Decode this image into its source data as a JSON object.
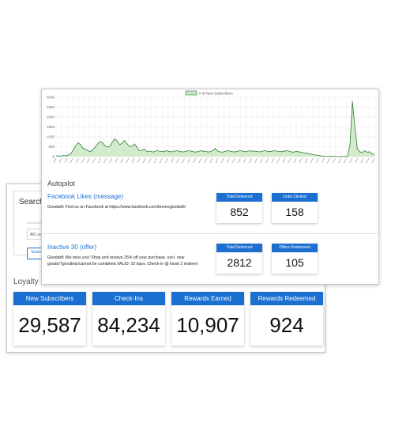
{
  "search": {
    "title": "Search",
    "location_label": "LOCATION",
    "location_value": "All Locations",
    "button_label": "Search"
  },
  "loyalty": {
    "title": "Loyalty",
    "stats": [
      {
        "label": "New Subscribers",
        "value": "29,587"
      },
      {
        "label": "Check-Ins",
        "value": "84,234"
      },
      {
        "label": "Rewards Earned",
        "value": "10,907"
      },
      {
        "label": "Rewards Redeemed",
        "value": "924"
      }
    ]
  },
  "autopilot": {
    "title": "Autopilot",
    "offers": [
      {
        "title": "Facebook Likes (message)",
        "body": "Goodwill: Find us on Facebook at https://www.facebook.com/bmoregoodwill/",
        "metrics": [
          {
            "label": "Total Delivered",
            "value": "852"
          },
          {
            "label": "Links Clicked",
            "value": "158"
          }
        ]
      },
      {
        "title": "Inactive 30 (offer)",
        "body": "Goodwill: We miss you! Shop and receive 25% off your purchase. excl. new goods/Tg/outlets/cannot be combined.VALID: 10 days. Check-in @ kiosk 2 redeem",
        "metrics": [
          {
            "label": "Total Delivered",
            "value": "2812"
          },
          {
            "label": "Offers Redeemed",
            "value": "105"
          }
        ]
      }
    ]
  },
  "colors": {
    "accent": "#1a6fd0",
    "series_line": "#2e7d32",
    "series_fill": "#c8e6c0"
  },
  "chart_data": {
    "type": "area",
    "series": [
      {
        "name": "# of New Subscribers",
        "values": [
          30,
          40,
          25,
          60,
          45,
          80,
          150,
          350,
          550,
          700,
          600,
          420,
          380,
          300,
          250,
          350,
          480,
          650,
          760,
          700,
          550,
          480,
          520,
          750,
          900,
          780,
          600,
          680,
          820,
          650,
          500,
          520,
          640,
          480,
          300,
          320,
          380,
          260,
          280,
          250,
          240,
          300,
          280,
          260,
          250,
          300,
          270,
          240,
          260,
          300,
          280,
          250,
          240,
          260,
          300,
          280,
          250,
          230,
          260,
          300,
          270,
          280,
          230,
          260,
          300,
          420,
          280,
          240,
          230,
          260,
          300,
          280,
          250,
          240,
          260,
          300,
          280,
          250,
          260,
          300,
          270,
          280,
          260,
          240,
          260,
          300,
          280,
          250,
          270,
          300,
          280,
          260,
          250,
          270,
          300,
          280,
          240,
          230,
          260,
          250,
          220,
          200,
          180,
          150,
          120,
          100,
          80,
          60,
          40,
          30,
          20,
          15,
          10,
          10,
          5,
          5,
          10,
          5,
          8,
          10,
          600,
          2800,
          1500,
          400,
          250,
          200,
          300,
          220,
          250,
          150,
          100
        ]
      }
    ],
    "ylim": [
      0,
      3000
    ],
    "y_ticks": [
      "0",
      "500",
      "1000",
      "1500",
      "2000",
      "2500",
      "3000"
    ],
    "x_tick_count": 58,
    "grid": true,
    "legend": "top-center"
  }
}
